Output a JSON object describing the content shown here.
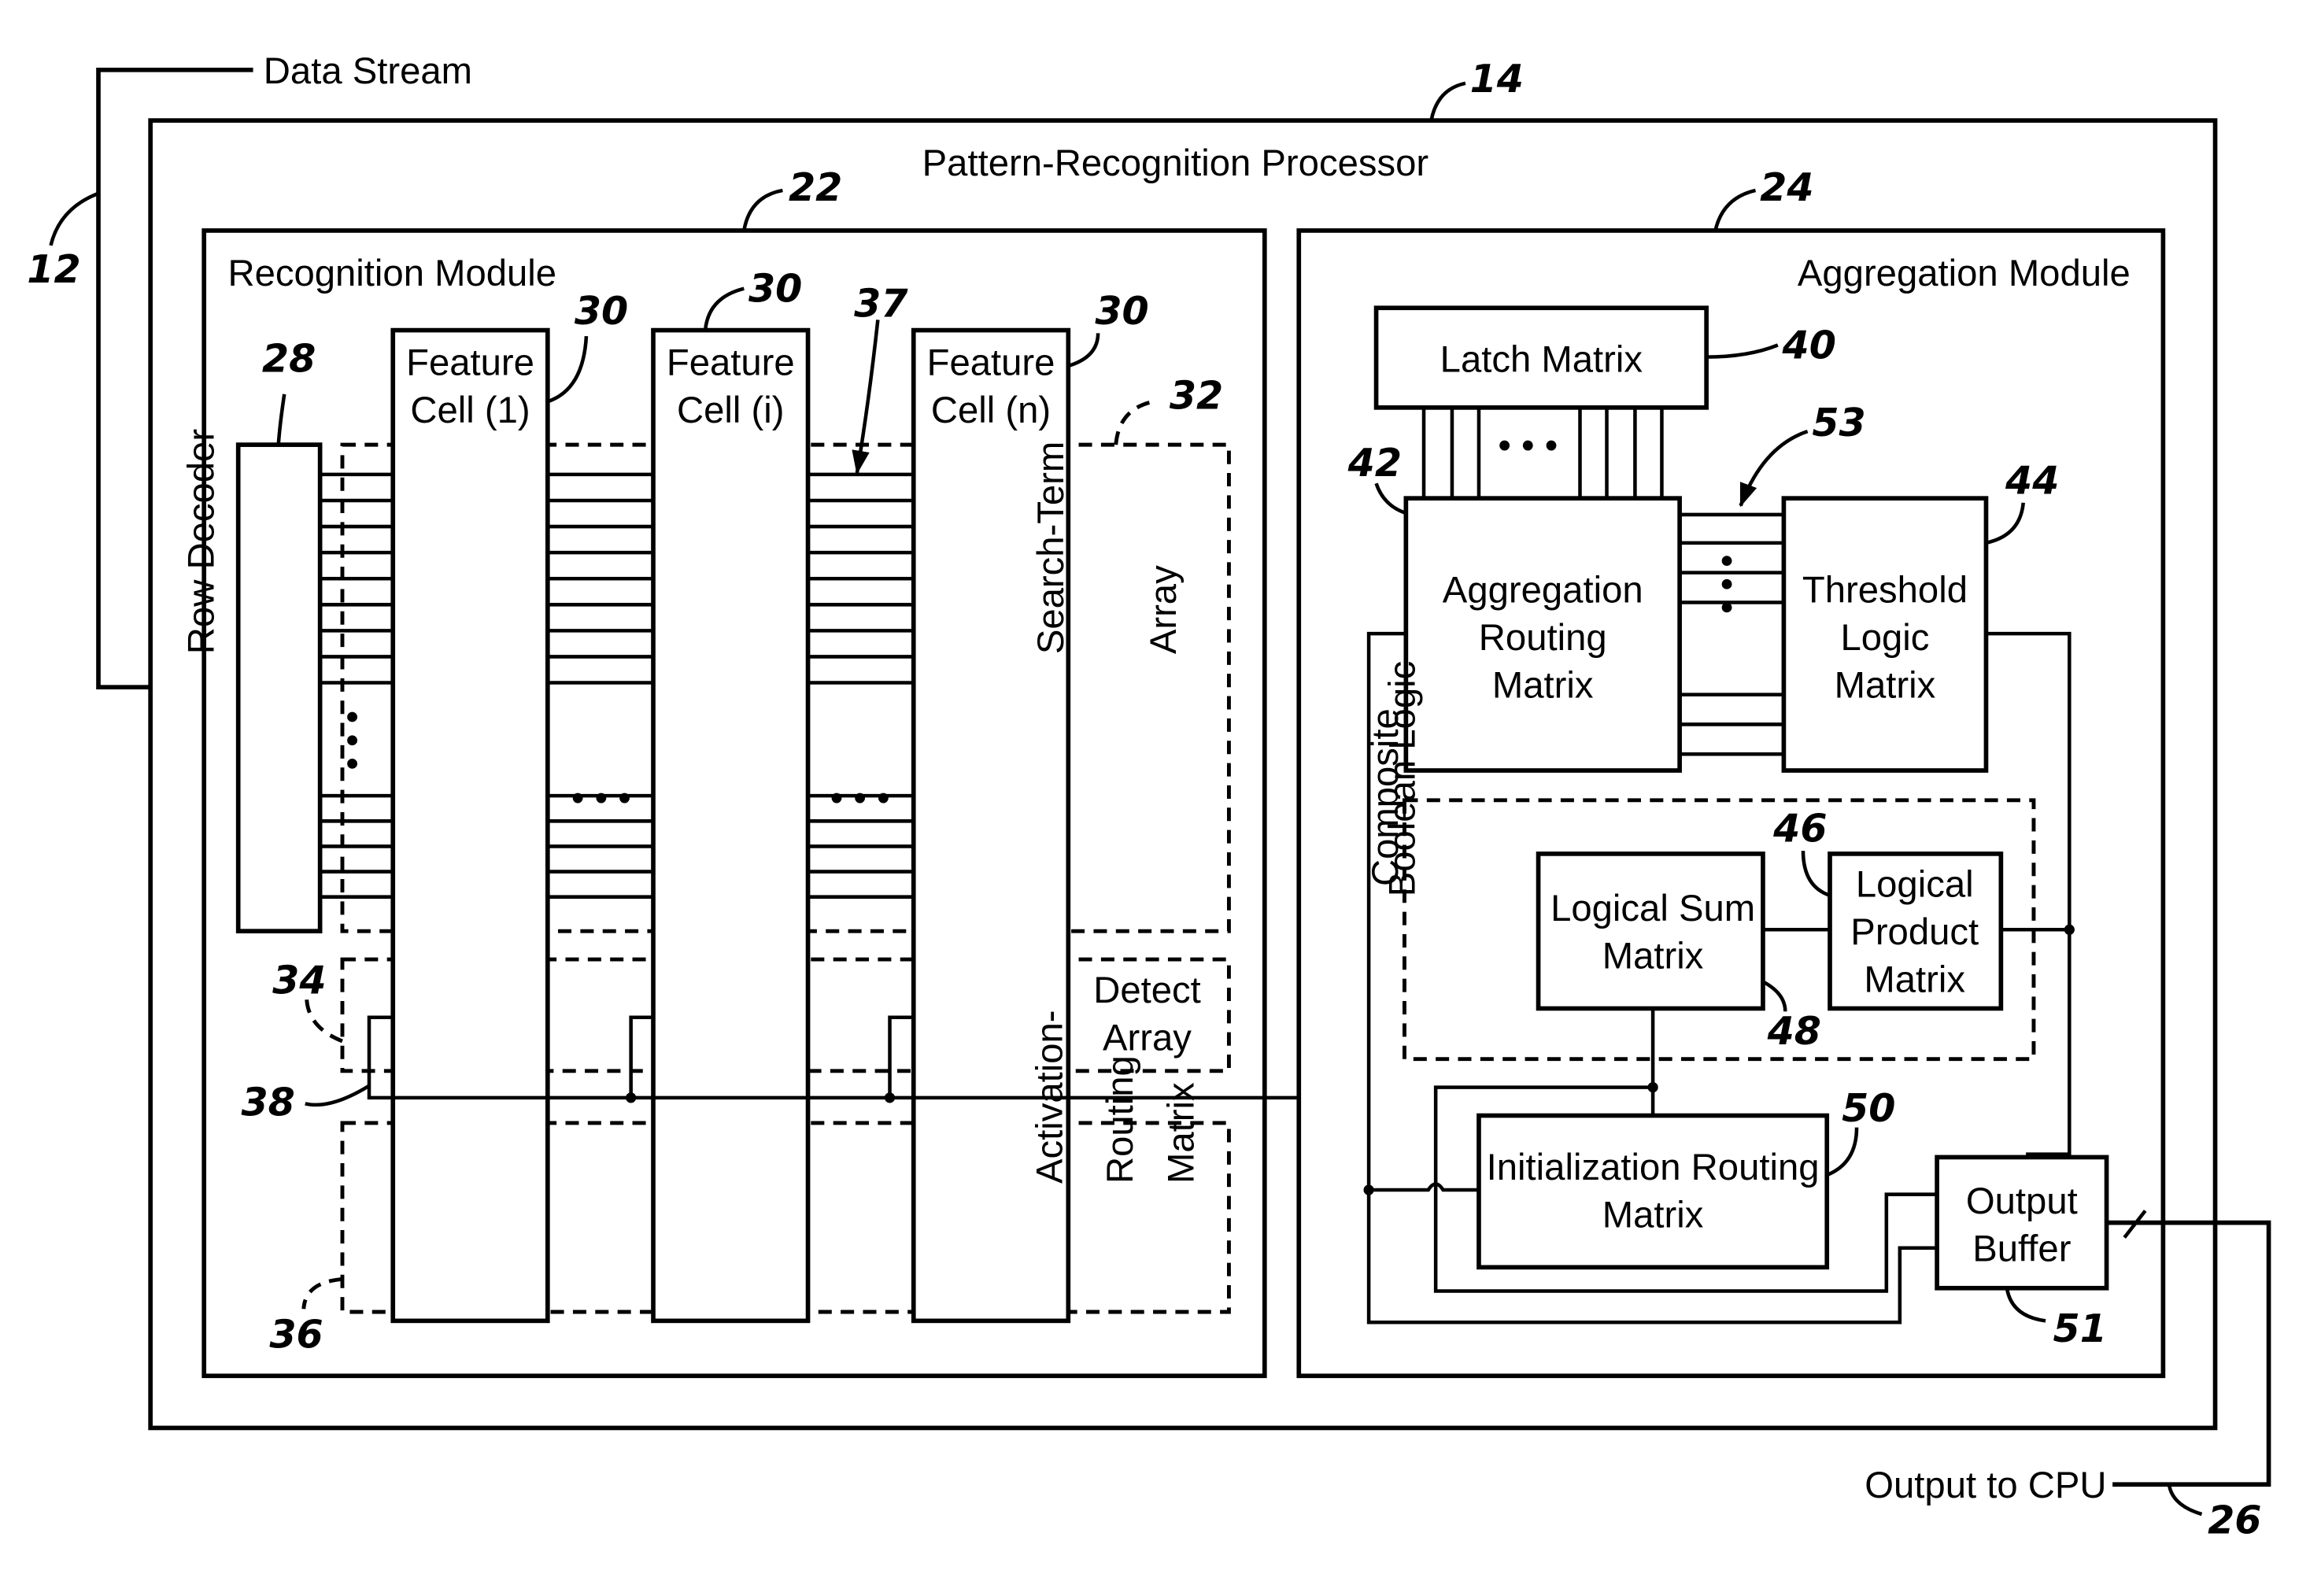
{
  "diagram": {
    "title": "Pattern-Recognition Processor",
    "ref_processor": "14",
    "input": {
      "label": "Data Stream",
      "ref": "12"
    },
    "output": {
      "label": "Output to CPU",
      "ref": "26"
    },
    "recognition_module": {
      "label": "Recognition Module",
      "ref": "22",
      "row_decoder": {
        "label": "Row Decoder",
        "ref": "28"
      },
      "feature_cells": [
        {
          "line1": "Feature",
          "line2": "Cell (1)",
          "ref": "30"
        },
        {
          "line1": "Feature",
          "line2": "Cell (i)",
          "ref": "30"
        },
        {
          "line1": "Feature",
          "line2": "Cell (n)",
          "ref": "30"
        }
      ],
      "search_term_array": {
        "line1": "Search-Term",
        "line2": "Array",
        "ref": "32"
      },
      "search_line_ref": "37",
      "detect_array": {
        "line1": "Detect",
        "line2": "Array",
        "ref": "34"
      },
      "detect_bus_ref": "38",
      "activation_routing_matrix": {
        "line1": "Activation-",
        "line2": "Routing",
        "line3": "Matrix",
        "ref": "36"
      },
      "ellipsis": "• • •"
    },
    "aggregation_module": {
      "label": "Aggregation Module",
      "ref": "24",
      "latch_matrix": {
        "label": "Latch Matrix",
        "ref": "40"
      },
      "aggregation_routing_matrix": {
        "line1": "Aggregation",
        "line2": "Routing",
        "line3": "Matrix",
        "ref": "42"
      },
      "threshold_logic_matrix": {
        "line1": "Threshold",
        "line2": "Logic",
        "line3": "Matrix",
        "ref": "44"
      },
      "bus_ref": "53",
      "composite_boolean_logic": {
        "line1": "Composite",
        "line2": "Boolean Logic"
      },
      "logical_sum_matrix": {
        "line1": "Logical Sum",
        "line2": "Matrix",
        "ref": "48"
      },
      "logical_product_matrix": {
        "line1": "Logical",
        "line2": "Product",
        "line3": "Matrix",
        "ref": "46"
      },
      "initialization_routing_matrix": {
        "line1": "Initialization Routing",
        "line2": "Matrix",
        "ref": "50"
      },
      "output_buffer": {
        "line1": "Output",
        "line2": "Buffer",
        "ref": "51"
      }
    }
  }
}
